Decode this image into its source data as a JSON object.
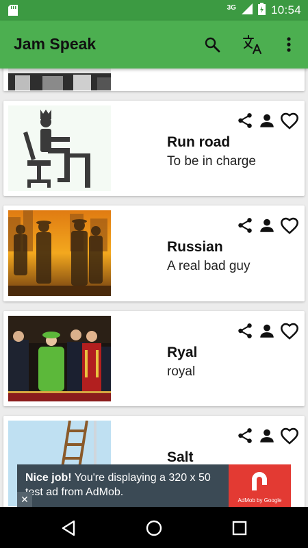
{
  "status_bar": {
    "network": "3G",
    "time": "10:54"
  },
  "app_bar": {
    "title": "Jam Speak"
  },
  "icons": [
    "sd-card-icon",
    "signal-icon",
    "battery-icon",
    "search-icon",
    "translate-icon",
    "more-vert-icon",
    "share-icon",
    "person-icon",
    "heart-icon"
  ],
  "cards": [
    {
      "word": "Run road",
      "meaning": "To be in charge",
      "image": "king-at-desk-icon"
    },
    {
      "word": "Russian",
      "meaning": "A real bad guy",
      "image": "gangster-silhouettes-photo"
    },
    {
      "word": "Ryal",
      "meaning": "royal",
      "image": "royal-family-balcony-photo"
    },
    {
      "word": "Salt",
      "meaning": "",
      "image": "ladder-cartoon"
    }
  ],
  "ad": {
    "headline": "Nice job!",
    "body": " You're displaying a 320 x 50 test ad from AdMob.",
    "logo_caption": "AdMob by Google",
    "close_label": "✕"
  },
  "colors": {
    "status_bar": "#3c9a42",
    "app_bar": "#4caf50",
    "ad_background": "#3b4a55",
    "admob_red": "#e33a33"
  }
}
